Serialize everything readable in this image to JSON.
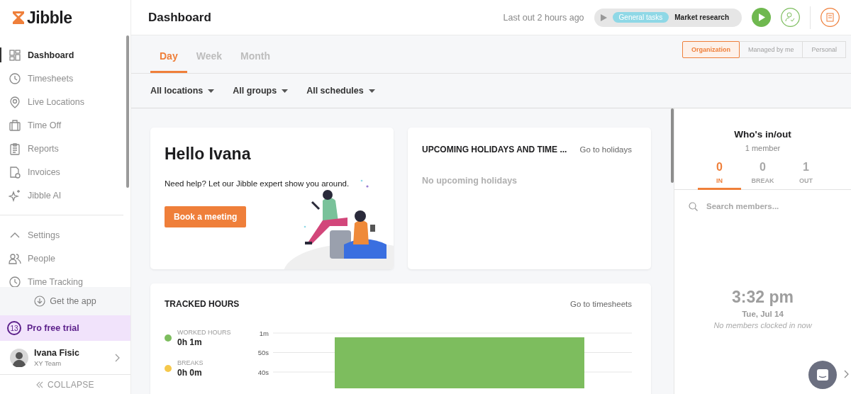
{
  "logo": {
    "text": "Jibble"
  },
  "sidebar": {
    "items": [
      {
        "label": "Dashboard",
        "selected": true
      },
      {
        "label": "Timesheets",
        "selected": false
      },
      {
        "label": "Live Locations",
        "selected": false
      },
      {
        "label": "Time Off",
        "selected": false
      },
      {
        "label": "Reports",
        "selected": false
      },
      {
        "label": "Invoices",
        "selected": false
      },
      {
        "label": "Jibble AI",
        "selected": false
      }
    ],
    "settings": {
      "label": "Settings",
      "expanded": true,
      "children": [
        {
          "label": "People"
        },
        {
          "label": "Time Tracking"
        }
      ]
    },
    "get_app": "Get the app",
    "trial": {
      "days": "13",
      "label": "Pro free trial"
    },
    "user": {
      "name": "Ivana Fisic",
      "team": "XY Team"
    },
    "collapse": "COLLAPSE"
  },
  "header": {
    "title": "Dashboard",
    "last_out": "Last out 2 hours ago",
    "timer": {
      "project": "General tasks",
      "task": "Market research"
    }
  },
  "period_tabs": [
    {
      "label": "Day",
      "selected": true
    },
    {
      "label": "Week",
      "selected": false
    },
    {
      "label": "Month",
      "selected": false
    }
  ],
  "scope": [
    {
      "label": "Organization",
      "selected": true
    },
    {
      "label": "Managed by me",
      "selected": false
    },
    {
      "label": "Personal",
      "selected": false
    }
  ],
  "filters": [
    "All locations",
    "All groups",
    "All schedules"
  ],
  "hello_card": {
    "title": "Hello Ivana",
    "text": "Need help? Let our Jibble expert show you around.",
    "button": "Book a meeting"
  },
  "holidays_card": {
    "title": "UPCOMING HOLIDAYS AND TIME ...",
    "link": "Go to holidays",
    "empty": "No upcoming holidays"
  },
  "tracked_card": {
    "title": "TRACKED HOURS",
    "link": "Go to timesheets",
    "legend": [
      {
        "label": "WORKED HOURS",
        "value": "0h 1m",
        "color": "#7dbd5e"
      },
      {
        "label": "BREAKS",
        "value": "0h 0m",
        "color": "#f5c84c"
      }
    ],
    "chart": {
      "y_axis_labels": [
        "1m",
        "50s",
        "40s"
      ]
    }
  },
  "who_panel": {
    "title": "Who's in/out",
    "count": "1 member",
    "stats": [
      {
        "value": "0",
        "label": "IN",
        "selected": true
      },
      {
        "value": "0",
        "label": "BREAK",
        "selected": false
      },
      {
        "value": "1",
        "label": "OUT",
        "selected": false
      }
    ],
    "search": {
      "placeholder": "Search members..."
    },
    "time": "3:32 pm",
    "date": "Tue, Jul 14",
    "empty": "No members clocked in now"
  }
}
